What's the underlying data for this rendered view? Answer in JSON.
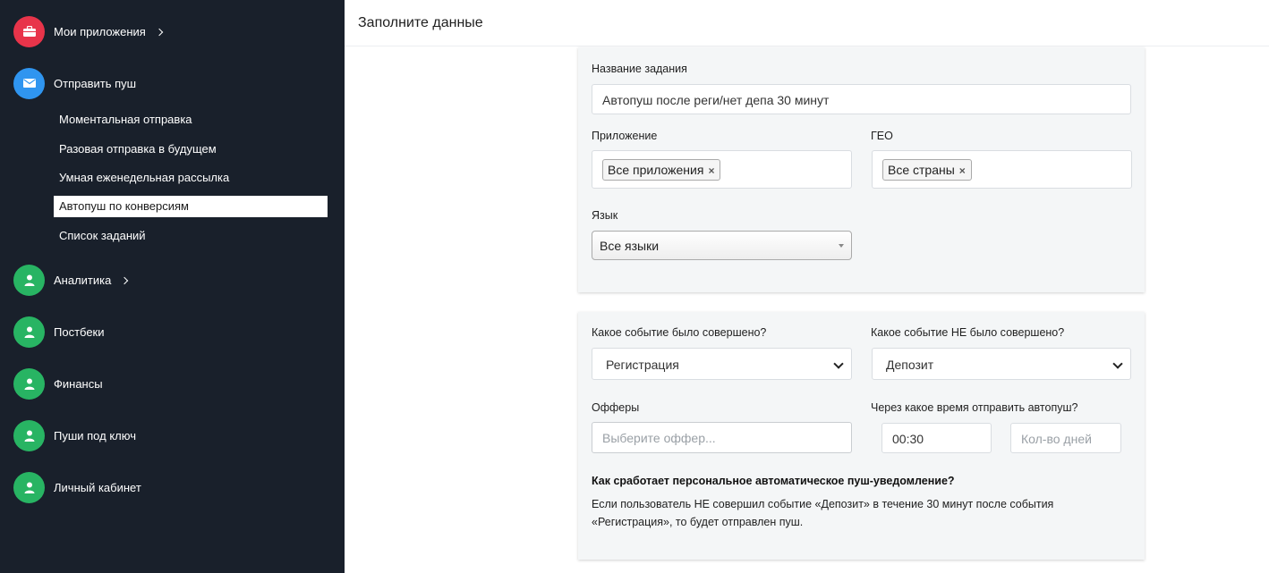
{
  "sidebar": {
    "items": [
      {
        "label": "Мои приложения",
        "color": "#e8344a",
        "icon": "briefcase-icon",
        "chevron": true
      },
      {
        "label": "Отправить пуш",
        "color": "#2f95f0",
        "icon": "mail-icon",
        "chevron": false
      },
      {
        "label": "Аналитика",
        "color": "#28b463",
        "icon": "user-icon",
        "chevron": true
      },
      {
        "label": "Постбеки",
        "color": "#28b463",
        "icon": "user-icon",
        "chevron": false
      },
      {
        "label": "Финансы",
        "color": "#28b463",
        "icon": "user-icon",
        "chevron": false
      },
      {
        "label": "Пуши под ключ",
        "color": "#28b463",
        "icon": "user-icon",
        "chevron": false
      },
      {
        "label": "Личный кабинет",
        "color": "#28b463",
        "icon": "user-icon",
        "chevron": false
      }
    ],
    "subitems": [
      {
        "label": "Моментальная отправка",
        "active": false
      },
      {
        "label": "Разовая отправка в будущем",
        "active": false
      },
      {
        "label": "Умная еженедельная рассылка",
        "active": false
      },
      {
        "label": "Автопуш по конверсиям",
        "active": true
      },
      {
        "label": "Список заданий",
        "active": false
      }
    ]
  },
  "header": {
    "title": "Заполните данные"
  },
  "form1": {
    "task_name_label": "Название задания",
    "task_name_value": "Автопуш после реги/нет депа 30 минут",
    "app_label": "Приложение",
    "app_chip": "Все приложения",
    "geo_label": "ГЕО",
    "geo_chip": "Все страны",
    "lang_label": "Язык",
    "lang_value": "Все языки"
  },
  "form2": {
    "event_done_label": "Какое событие было совершено?",
    "event_done_value": "Регистрация",
    "event_not_done_label": "Какое событие НЕ было совершено?",
    "event_not_done_value": "Депозит",
    "offers_label": "Офферы",
    "offers_placeholder": "Выберите оффер...",
    "time_label": "Через какое время отправить автопуш?",
    "time_value": "00:30",
    "days_placeholder": "Кол-во дней",
    "info_title": "Как сработает персональное автоматическое пуш-уведомление?",
    "info_text": "Если пользователь НЕ совершил событие «Депозит» в течение 30 минут после события «Регистрация», то будет отправлен пуш."
  },
  "chip_remove_symbol": "×"
}
